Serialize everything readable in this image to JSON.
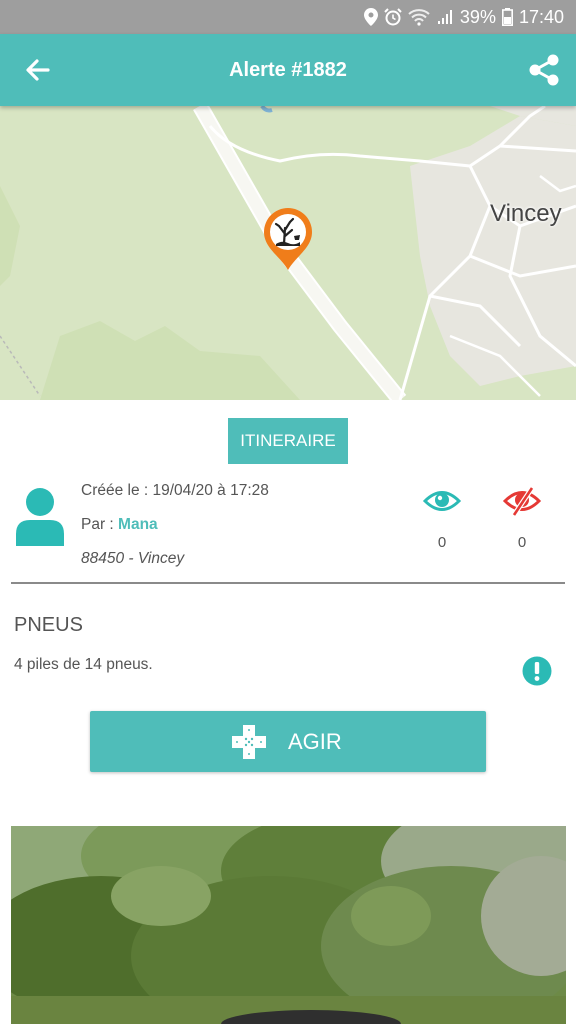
{
  "status_bar": {
    "battery": "39%",
    "time": "17:40",
    "icons": [
      "location-icon",
      "alarm-icon",
      "wifi-icon",
      "signal-icon",
      "battery-icon"
    ]
  },
  "app_bar": {
    "title": "Alerte #1882",
    "left_icon": "back-arrow-icon",
    "right_icon": "share-icon"
  },
  "map": {
    "place_label": "Vincey",
    "marker_icon": "pollution-marker-icon"
  },
  "itinerary_button": "ITINERAIRE",
  "alert": {
    "created": "Créée le : 19/04/20 à 17:28",
    "author_prefix": "Par : ",
    "author_name": "Mana",
    "location": "88450 - Vincey",
    "seen_count": "0",
    "unseen_count": "0",
    "category": "PNEUS",
    "description": "4 piles de 14 pneus."
  },
  "action_button": {
    "label": "AGIR",
    "icon": "bandage-cross-icon"
  },
  "colors": {
    "accent": "#4fbdb9",
    "status_bar": "#9e9e9e",
    "marker": "#f07d1a",
    "unseen": "#e53935"
  }
}
